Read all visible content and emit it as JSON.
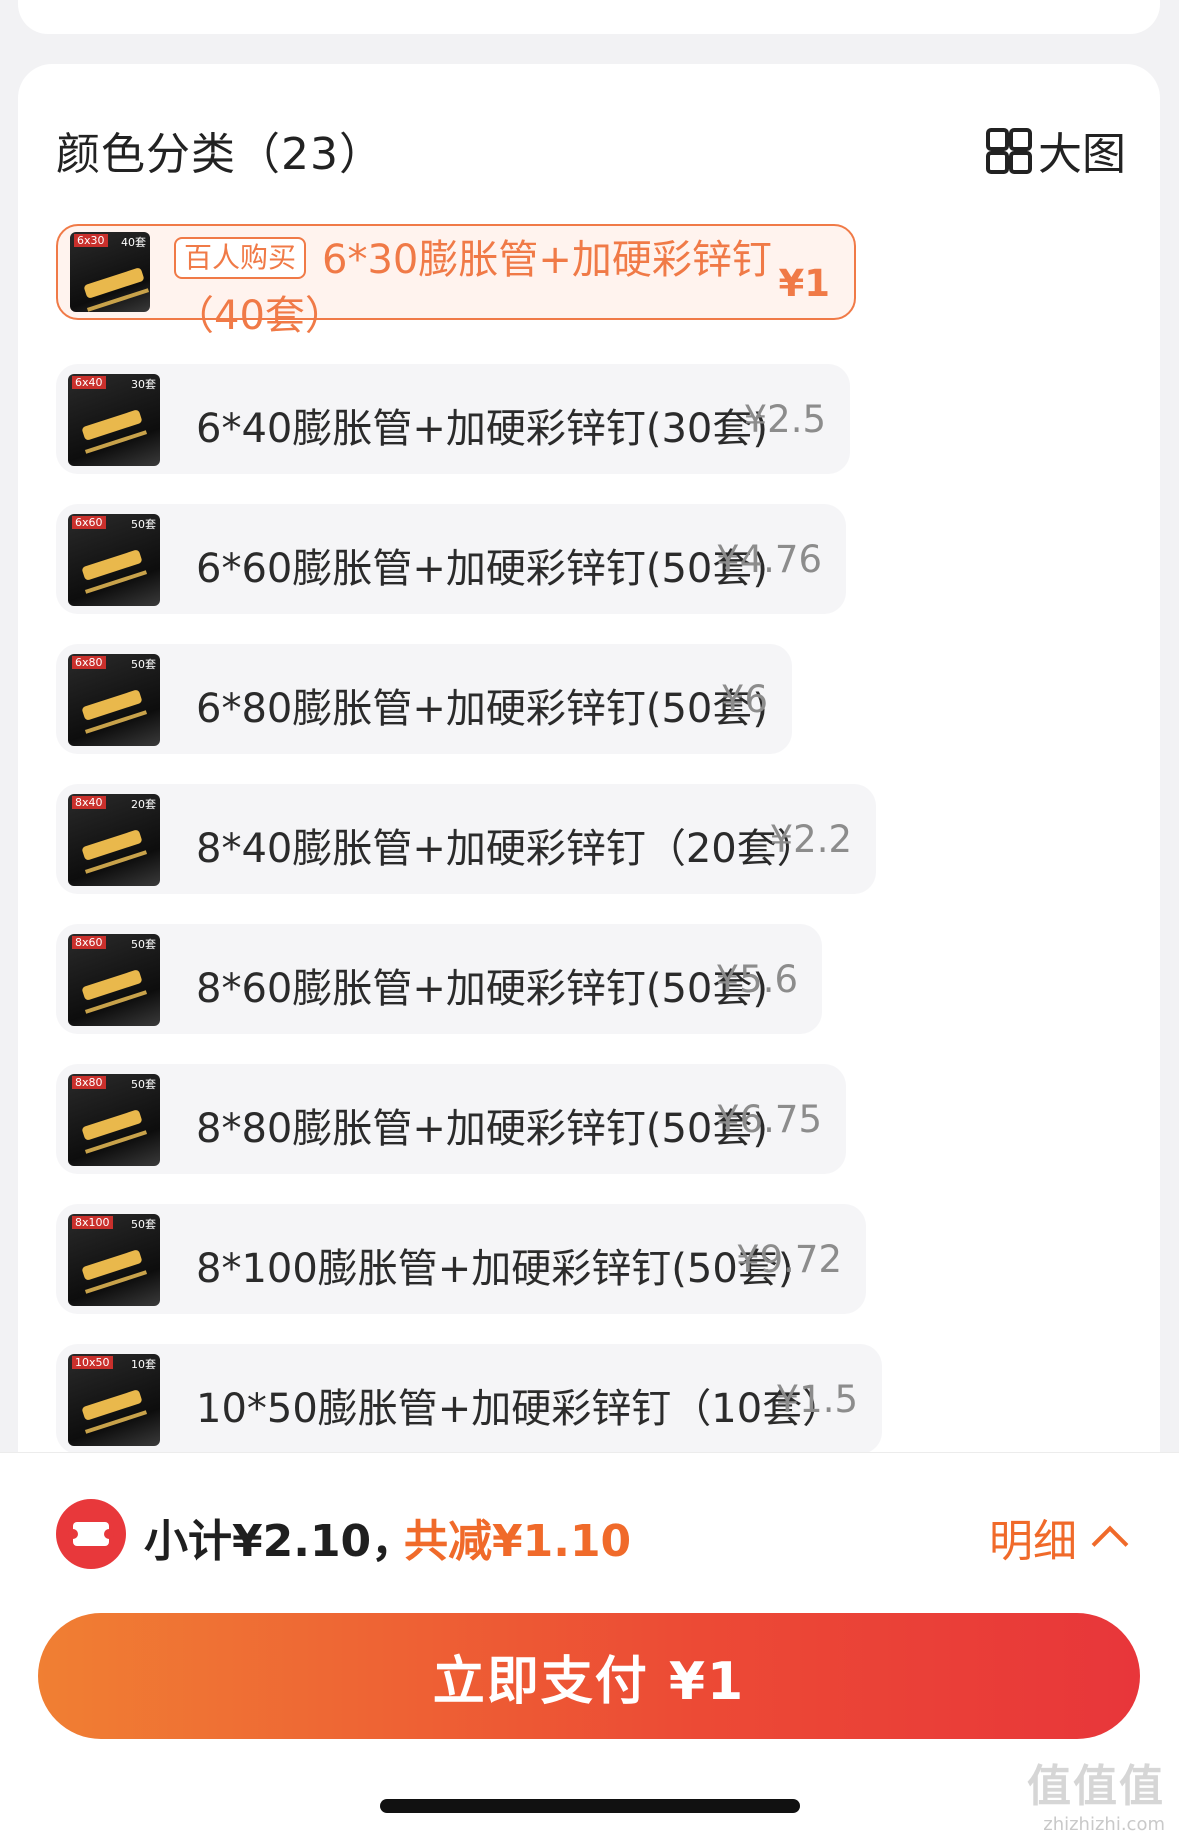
{
  "section": {
    "title": "颜色分类（23）",
    "big_view_label": "大图"
  },
  "items": [
    {
      "badge": "百人购买",
      "label": "6*30膨胀管+加硬彩锌钉（40套）",
      "price": "¥1",
      "thumb_size": "6x30",
      "thumb_qty": "40套",
      "selected": true
    },
    {
      "label": "6*40膨胀管+加硬彩锌钉(30套)",
      "price": "¥2.5",
      "thumb_size": "6x40",
      "thumb_qty": "30套"
    },
    {
      "label": "6*60膨胀管+加硬彩锌钉(50套)",
      "price": "¥4.76",
      "thumb_size": "6x60",
      "thumb_qty": "50套"
    },
    {
      "label": "6*80膨胀管+加硬彩锌钉(50套)",
      "price": "¥6",
      "thumb_size": "6x80",
      "thumb_qty": "50套"
    },
    {
      "label": "8*40膨胀管+加硬彩锌钉（20套）",
      "price": "¥2.2",
      "thumb_size": "8x40",
      "thumb_qty": "20套"
    },
    {
      "label": "8*60膨胀管+加硬彩锌钉(50套)",
      "price": "¥5.6",
      "thumb_size": "8x60",
      "thumb_qty": "50套"
    },
    {
      "label": "8*80膨胀管+加硬彩锌钉(50套)",
      "price": "¥6.75",
      "thumb_size": "8x80",
      "thumb_qty": "50套"
    },
    {
      "label": "8*100膨胀管+加硬彩锌钉(50套)",
      "price": "¥9.72",
      "thumb_size": "8x100",
      "thumb_qty": "50套"
    },
    {
      "label": "10*50膨胀管+加硬彩锌钉（10套）",
      "price": "¥1.5",
      "thumb_size": "10x50",
      "thumb_qty": "10套"
    }
  ],
  "footer": {
    "subtotal": "小计¥2.10，",
    "discount": "共减¥1.10",
    "detail_label": "明细",
    "pay_label": "立即支付 ¥1"
  },
  "watermark": {
    "big": "值值值",
    "small": "zhizhizhi.com"
  },
  "colors": {
    "accent": "#f07a47",
    "price_gray": "#8c8c8c",
    "pay_start": "#f07f33",
    "pay_end": "#e8363a"
  }
}
